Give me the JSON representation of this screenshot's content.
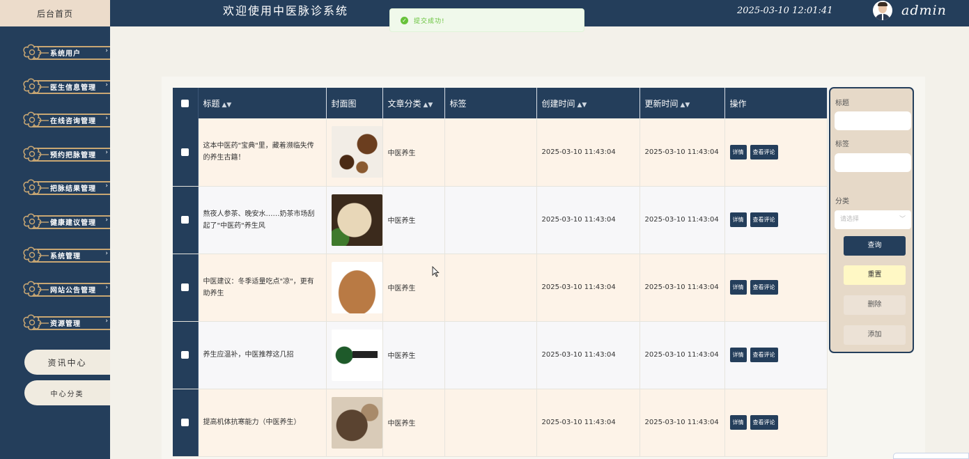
{
  "header": {
    "home_tab": "后台首页",
    "title": "欢迎使用中医脉诊系统",
    "datetime": "2025-03-10 12:01:41",
    "user": "admin"
  },
  "toast": {
    "message": "提交成功!"
  },
  "sidebar": {
    "items": [
      {
        "label": "系统用户"
      },
      {
        "label": "医生信息管理"
      },
      {
        "label": "在线咨询管理"
      },
      {
        "label": "预约把脉管理"
      },
      {
        "label": "把脉结果管理"
      },
      {
        "label": "健康建议管理"
      },
      {
        "label": "系统管理"
      },
      {
        "label": "网站公告管理"
      },
      {
        "label": "资源管理"
      }
    ],
    "sub_items": [
      {
        "label": "资讯中心"
      },
      {
        "label": "中心分类"
      }
    ]
  },
  "table": {
    "columns": {
      "title": "标题",
      "cover": "封面图",
      "category": "文章分类",
      "tags": "标签",
      "created": "创建时间",
      "updated": "更新时间",
      "ops": "操作"
    },
    "detail_label": "详情",
    "comments_label": "查看评论",
    "rows": [
      {
        "title": "这本中医药\"宝典\"里，藏着濒临失传的养生古籍！",
        "category": "中医养生",
        "tags": "",
        "created": "2025-03-10 11:43:04",
        "updated": "2025-03-10 11:43:04"
      },
      {
        "title": "熬夜人参茶、晚安水……奶茶市场刮起了\"中医药\"养生风",
        "category": "中医养生",
        "tags": "",
        "created": "2025-03-10 11:43:04",
        "updated": "2025-03-10 11:43:04"
      },
      {
        "title": "中医建议：冬季适量吃点\"凉\"，更有助养生",
        "category": "中医养生",
        "tags": "",
        "created": "2025-03-10 11:43:04",
        "updated": "2025-03-10 11:43:04"
      },
      {
        "title": "养生应温补，中医推荐这几招",
        "category": "中医养生",
        "tags": "",
        "created": "2025-03-10 11:43:04",
        "updated": "2025-03-10 11:43:04"
      },
      {
        "title": "提高机体抗寒能力（中医养生）",
        "category": "中医养生",
        "tags": "",
        "created": "2025-03-10 11:43:04",
        "updated": "2025-03-10 11:43:04"
      }
    ]
  },
  "filter": {
    "title_label": "标题",
    "tags_label": "标签",
    "category_label": "分类",
    "category_placeholder": "请选择",
    "query_button": "查询",
    "reset_button": "重置",
    "delete_button": "删除",
    "add_button": "添加"
  },
  "colors": {
    "navy": "#243e5b",
    "beige": "#ecdccb",
    "gold": "#c9a773",
    "success": "#67c23a"
  }
}
